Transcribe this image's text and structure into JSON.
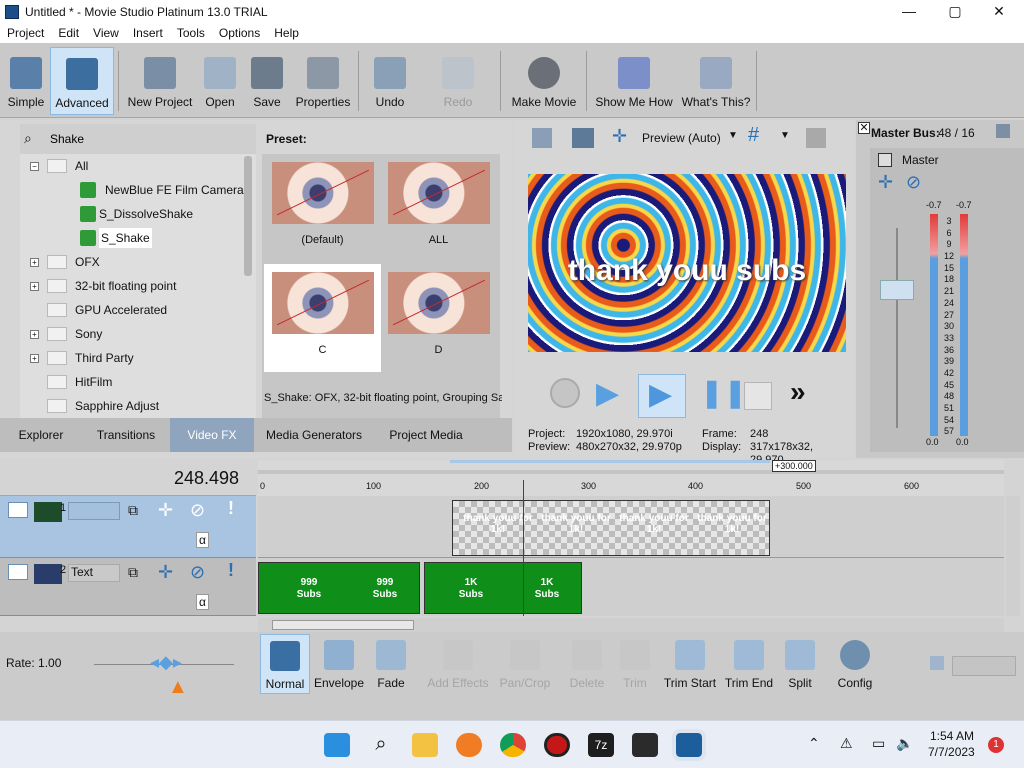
{
  "window": {
    "title": "Untitled * - Movie Studio Platinum 13.0 TRIAL",
    "controls": {
      "minimize": "—",
      "maximize": "▢",
      "close": "✕"
    }
  },
  "menu": [
    "Project",
    "Edit",
    "View",
    "Insert",
    "Tools",
    "Options",
    "Help"
  ],
  "toolbar": {
    "items": [
      {
        "label": "Simple",
        "icon": "simple-view-icon"
      },
      {
        "label": "Advanced",
        "icon": "advanced-view-icon",
        "active": true
      },
      {
        "label": "New Project",
        "icon": "new-project-icon"
      },
      {
        "label": "Open",
        "icon": "open-folder-icon"
      },
      {
        "label": "Save",
        "icon": "save-disk-icon"
      },
      {
        "label": "Properties",
        "icon": "properties-icon"
      },
      {
        "label": "Undo",
        "icon": "undo-icon"
      },
      {
        "label": "Redo",
        "icon": "redo-icon",
        "disabled": true
      },
      {
        "label": "Make Movie",
        "icon": "film-reel-icon"
      },
      {
        "label": "Show Me How",
        "icon": "pointer-hand-icon"
      },
      {
        "label": "What's This?",
        "icon": "help-cursor-icon"
      }
    ]
  },
  "explorer": {
    "search_value": "Shake",
    "tree": [
      {
        "label": "All",
        "type": "folder",
        "expanded": true
      },
      {
        "label": "NewBlue FE Film Camera",
        "type": "fx"
      },
      {
        "label": "S_DissolveShake",
        "type": "fx"
      },
      {
        "label": "S_Shake",
        "type": "fx",
        "selected": true
      },
      {
        "label": "OFX",
        "type": "folder"
      },
      {
        "label": "32-bit floating point",
        "type": "folder"
      },
      {
        "label": "GPU Accelerated",
        "type": "folder"
      },
      {
        "label": "Sony",
        "type": "folder"
      },
      {
        "label": "Third Party",
        "type": "folder"
      },
      {
        "label": "HitFilm",
        "type": "folder"
      },
      {
        "label": "Sapphire Adjust",
        "type": "folder"
      }
    ],
    "preset_heading": "Preset:",
    "presets": [
      {
        "label": "(Default)"
      },
      {
        "label": "ALL"
      },
      {
        "label": "C",
        "selected": true
      },
      {
        "label": "D"
      }
    ],
    "status_text": "S_Shake: OFX, 32-bit floating point, Grouping  Sa",
    "tabs": [
      "Explorer",
      "Transitions",
      "Video FX",
      "Media Generators",
      "Project Media"
    ],
    "active_tab": "Video FX"
  },
  "preview": {
    "mode_label": "Preview (Auto)",
    "overlay_text": "thank youu subs",
    "project_label": "Project:",
    "project_value": "1920x1080, 29.970i",
    "preview_label": "Preview:",
    "preview_value": "480x270x32, 29.970p",
    "frame_label": "Frame:",
    "frame_value": "248",
    "display_label": "Display:",
    "display_value": "317x178x32, 29.970"
  },
  "master_bus": {
    "title": "Master Bus:",
    "counter": "48 / 16",
    "label": "Master",
    "peak_left": "-0.7",
    "peak_right": "-0.7",
    "scale": [
      "3",
      "6",
      "9",
      "12",
      "15",
      "18",
      "21",
      "24",
      "27",
      "30",
      "33",
      "36",
      "39",
      "42",
      "45",
      "48",
      "51",
      "54",
      "57"
    ],
    "bottom_left": "0.0",
    "bottom_right": "0.0"
  },
  "timeline": {
    "time_display": "248.498",
    "ruler_ticks": [
      "0",
      "100",
      "200",
      "300",
      "400",
      "500",
      "600"
    ],
    "tooltip": "+300.000",
    "tracks": [
      {
        "number": "1",
        "name": ""
      },
      {
        "number": "2",
        "name": "Text"
      }
    ],
    "track1_clips": [
      "thank youu for 1k!",
      "thank youu for 1k!",
      "thank youu for 1k!",
      "thank youu for 1k!"
    ],
    "track2_clips": [
      {
        "line1": "999",
        "line2": "Subs"
      },
      {
        "line1": "999",
        "line2": "Subs"
      },
      {
        "line1": "1K",
        "line2": "Subs"
      },
      {
        "line1": "1K",
        "line2": "Subs"
      }
    ],
    "rate_label": "Rate: 1.00"
  },
  "edit_tools": [
    {
      "label": "Normal",
      "icon": "normal-edit-icon",
      "active": true
    },
    {
      "label": "Envelope",
      "icon": "envelope-icon"
    },
    {
      "label": "Fade",
      "icon": "fade-icon"
    },
    {
      "label": "Add Effects",
      "icon": "add-effects-icon",
      "disabled": true
    },
    {
      "label": "Pan/Crop",
      "icon": "pan-crop-icon",
      "disabled": true
    },
    {
      "label": "Delete",
      "icon": "delete-x-icon",
      "disabled": true
    },
    {
      "label": "Trim",
      "icon": "trim-icon",
      "disabled": true
    },
    {
      "label": "Trim Start",
      "icon": "trim-start-icon"
    },
    {
      "label": "Trim End",
      "icon": "trim-end-icon"
    },
    {
      "label": "Split",
      "icon": "split-icon"
    },
    {
      "label": "Config",
      "icon": "config-gear-icon"
    }
  ],
  "taskbar": {
    "time": "1:54 AM",
    "date": "7/7/2023",
    "notification_count": "1",
    "apps": [
      "windows-start-icon",
      "search-icon",
      "file-explorer-icon",
      "firefox-icon",
      "chrome-icon",
      "screen-recorder-icon",
      "7zip-icon",
      "terminal-icon",
      "movie-studio-icon"
    ]
  },
  "colors": {
    "accent": "#3d8fd6",
    "clip_green": "#0f8f1a",
    "clip_border": "#333333",
    "active_tab": "#3d8fd6"
  }
}
